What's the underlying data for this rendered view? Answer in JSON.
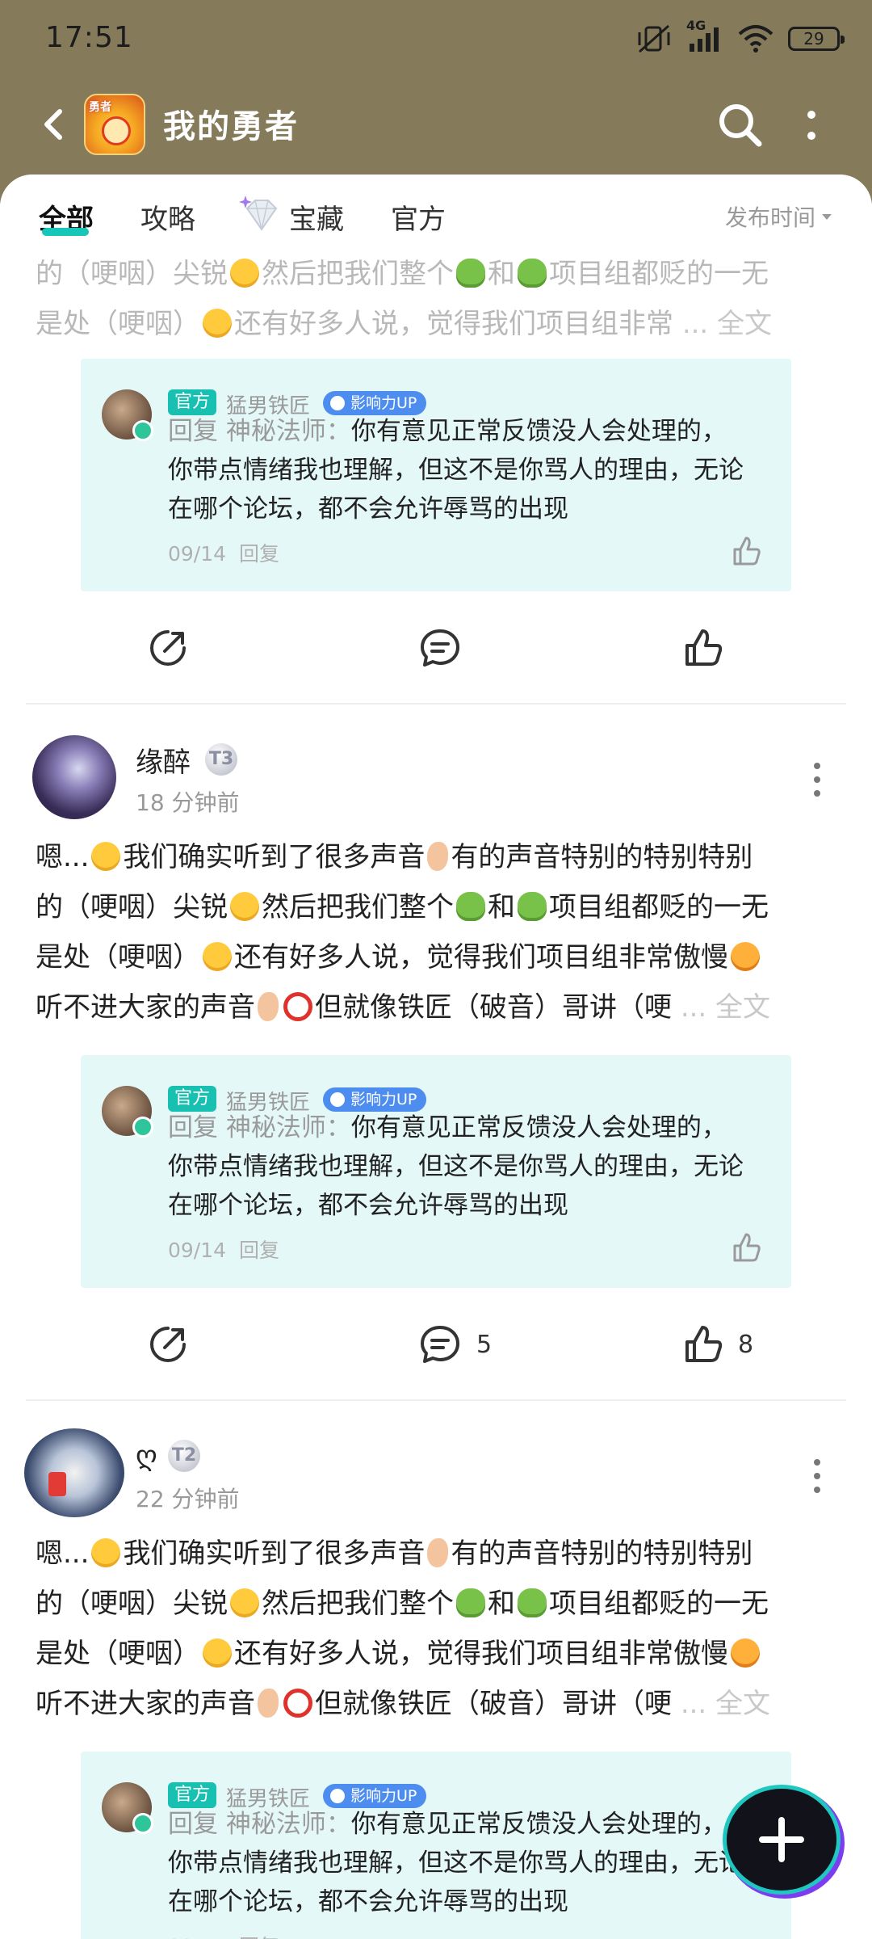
{
  "status_bar": {
    "time": "17:51",
    "network": "4G",
    "battery": "29",
    "icons": [
      "mute-vibrate-icon",
      "cellular-signal-icon",
      "wifi-icon",
      "battery-icon"
    ]
  },
  "header": {
    "title": "我的勇者",
    "logo_text": "勇者"
  },
  "tabs": [
    {
      "label": "全部",
      "active": true
    },
    {
      "label": "攻略",
      "active": false
    },
    {
      "label": "宝藏",
      "active": false
    },
    {
      "label": "官方",
      "active": false
    }
  ],
  "sort": {
    "label": "发布时间"
  },
  "quote": {
    "badge": "官方",
    "author": "猛男铁匠",
    "influence": "影响力UP",
    "reply_prefix": "回复 神秘法师：",
    "line1": "你有意见正常反馈没人会处理的，",
    "line2": "你带点情绪我也理解，但这不是你骂人的理由，无论",
    "line3": "在哪个论坛，都不会允许辱骂的出现",
    "date": "09/14",
    "reply_label": "回复"
  },
  "more_label": "... 全文",
  "post_text": {
    "l1a": "嗯...",
    "l1b": "我们确实听到了很多声音",
    "l1c": "有的声音特别的特别特别",
    "l2a": "的（哽咽）尖锐",
    "l2b": "然后把我们整个",
    "l2c": "和",
    "l2d": "项目组都贬的一无",
    "l3a": "是处（哽咽）",
    "l3b": "还有好多人说，觉得我们项目组非常",
    "l3c": "傲慢",
    "l4a": "听不进大家的声音",
    "l4b": "但就像铁匠（破音）哥讲（哽"
  },
  "posts": [
    {
      "user": "缘醉",
      "level": "T3",
      "time": "18 分钟前",
      "comments": "5",
      "likes": "8"
    },
    {
      "user": "ღ",
      "level": "T2",
      "time": "22 分钟前",
      "comments": "",
      "likes": ""
    }
  ],
  "colors": {
    "accent": "#16c6b8",
    "header_bg": "#857b5b",
    "quote_bg": "#e5f8f8",
    "influence": "#4d8df0"
  }
}
